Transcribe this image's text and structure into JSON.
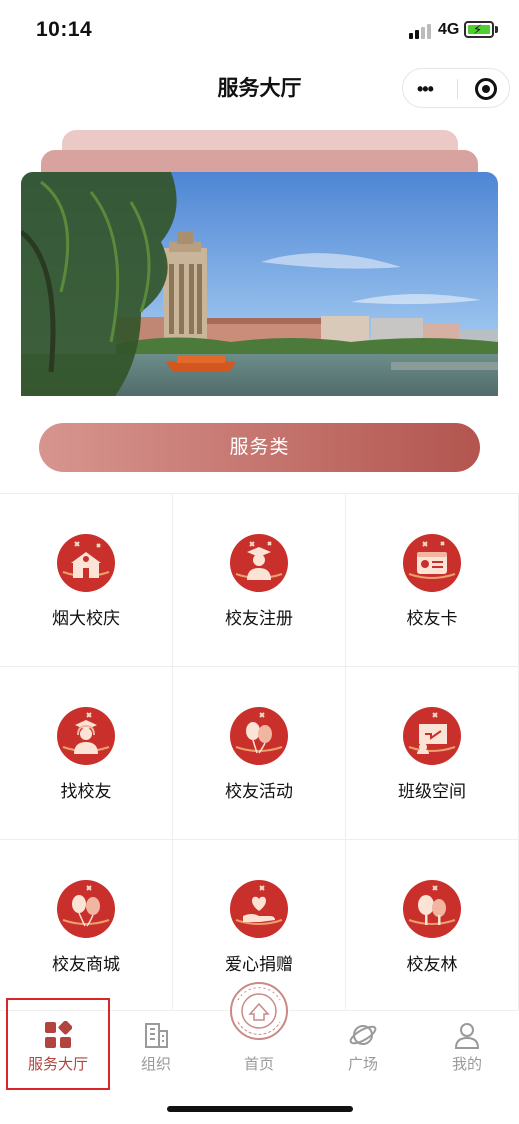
{
  "status_bar": {
    "time": "10:14",
    "network": "4G"
  },
  "nav": {
    "title": "服务大厅",
    "more_icon": "more-dots-icon",
    "close_icon": "target-icon"
  },
  "banner": {
    "image": "campus-lake-clock-tower-photo"
  },
  "category": {
    "label": "服务类"
  },
  "services": [
    {
      "label": "烟大校庆",
      "icon": "school-building-icon"
    },
    {
      "label": "校友注册",
      "icon": "graduate-person-icon"
    },
    {
      "label": "校友卡",
      "icon": "id-card-icon"
    },
    {
      "label": "找校友",
      "icon": "person-headset-icon"
    },
    {
      "label": "校友活动",
      "icon": "balloons-icon"
    },
    {
      "label": "班级空间",
      "icon": "chalkboard-icon"
    },
    {
      "label": "校友商城",
      "icon": "balloons-shop-icon"
    },
    {
      "label": "爱心捐赠",
      "icon": "heart-hand-icon"
    },
    {
      "label": "校友林",
      "icon": "trees-icon"
    }
  ],
  "tabbar": {
    "active_index": 0,
    "items": [
      {
        "label": "服务大厅",
        "icon": "grid-diamond-icon"
      },
      {
        "label": "组织",
        "icon": "building-icon"
      },
      {
        "label": "首页",
        "icon": "university-seal-icon"
      },
      {
        "label": "广场",
        "icon": "planet-icon"
      },
      {
        "label": "我的",
        "icon": "user-icon"
      }
    ]
  },
  "colors": {
    "accent": "#b3433d",
    "icon_circle": "#c9302c",
    "pill_start": "#d7958f",
    "pill_end": "#b3554f"
  }
}
